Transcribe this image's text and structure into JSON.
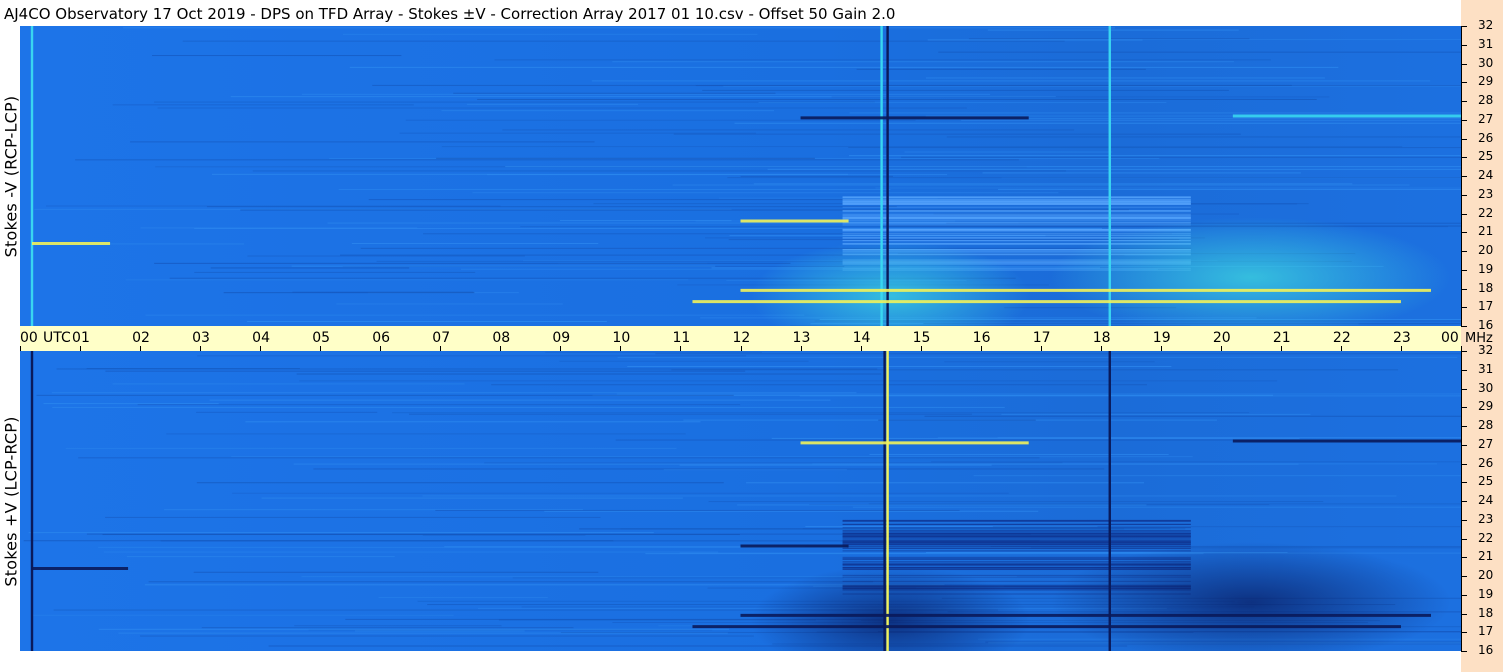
{
  "header": {
    "title": "AJ4CO Observatory  17 Oct 2019  -  DPS on TFD Array  -  Stokes ±V  -  Correction Array 2017 01 10.csv  -  Offset 50  Gain 2.0"
  },
  "colors": {
    "background_blue": "#1f73e6",
    "dark_band": "#0a1a5a",
    "cyan": "#39d6f0",
    "yellow": "#f2f25a",
    "time_bar": "#ffffc8",
    "freq_column": "#fde0c4"
  },
  "chart_data": [
    {
      "type": "heatmap",
      "ylabel": "Stokes -V (RCP-LCP)",
      "x_axis": {
        "label_prefix": "UTC",
        "range_hours": [
          0,
          24
        ],
        "tick_labels": [
          "00",
          "01",
          "02",
          "03",
          "04",
          "05",
          "06",
          "07",
          "08",
          "09",
          "10",
          "11",
          "12",
          "13",
          "14",
          "15",
          "16",
          "17",
          "18",
          "19",
          "20",
          "21",
          "22",
          "23",
          "00"
        ]
      },
      "y_axis": {
        "unit": "MHz",
        "range": [
          16,
          32
        ],
        "tick_labels": [
          "32",
          "31",
          "30",
          "29",
          "28",
          "27",
          "26",
          "25",
          "24",
          "23",
          "22",
          "21",
          "20",
          "19",
          "18",
          "17",
          "16"
        ]
      },
      "features": [
        {
          "kind": "vline",
          "hour": 0.2,
          "color": "cyan"
        },
        {
          "kind": "vline",
          "hour": 14.45,
          "color": "dark"
        },
        {
          "kind": "vline",
          "hour": 14.35,
          "color": "cyan"
        },
        {
          "kind": "vline",
          "hour": 18.15,
          "color": "cyan"
        },
        {
          "kind": "hband",
          "mhz": 27.1,
          "from": 13.0,
          "to": 16.8,
          "color": "dark"
        },
        {
          "kind": "hband",
          "mhz": 27.2,
          "from": 20.2,
          "to": 24.0,
          "color": "cyan"
        },
        {
          "kind": "hband",
          "mhz": 17.9,
          "from": 12.0,
          "to": 23.5,
          "color": "yellow"
        },
        {
          "kind": "hband",
          "mhz": 17.3,
          "from": 11.2,
          "to": 23.0,
          "color": "yellow"
        },
        {
          "kind": "hband",
          "mhz": 21.6,
          "from": 12.0,
          "to": 13.8,
          "color": "yellow"
        },
        {
          "kind": "hband",
          "mhz": 20.4,
          "from": 0.2,
          "to": 1.5,
          "color": "yellow"
        }
      ]
    },
    {
      "type": "heatmap",
      "ylabel": "Stokes +V (LCP-RCP)",
      "x_axis": {
        "label_prefix": "UTC",
        "range_hours": [
          0,
          24
        ],
        "tick_labels": [
          "00",
          "01",
          "02",
          "03",
          "04",
          "05",
          "06",
          "07",
          "08",
          "09",
          "10",
          "11",
          "12",
          "13",
          "14",
          "15",
          "16",
          "17",
          "18",
          "19",
          "20",
          "21",
          "22",
          "23",
          "00"
        ]
      },
      "y_axis": {
        "unit": "MHz",
        "range": [
          16,
          32
        ],
        "tick_labels": [
          "32",
          "31",
          "30",
          "29",
          "28",
          "27",
          "26",
          "25",
          "24",
          "23",
          "22",
          "21",
          "20",
          "19",
          "18",
          "17",
          "16"
        ]
      },
      "features": [
        {
          "kind": "vline",
          "hour": 0.2,
          "color": "dark"
        },
        {
          "kind": "vline",
          "hour": 14.45,
          "color": "yellow"
        },
        {
          "kind": "vline",
          "hour": 14.4,
          "color": "dark"
        },
        {
          "kind": "vline",
          "hour": 18.15,
          "color": "dark"
        },
        {
          "kind": "hband",
          "mhz": 27.1,
          "from": 13.0,
          "to": 16.8,
          "color": "yellow"
        },
        {
          "kind": "hband",
          "mhz": 27.2,
          "from": 20.2,
          "to": 24.0,
          "color": "dark"
        },
        {
          "kind": "hband",
          "mhz": 17.9,
          "from": 12.0,
          "to": 23.5,
          "color": "dark"
        },
        {
          "kind": "hband",
          "mhz": 17.3,
          "from": 11.2,
          "to": 23.0,
          "color": "dark"
        },
        {
          "kind": "hband",
          "mhz": 21.6,
          "from": 12.0,
          "to": 13.8,
          "color": "dark"
        },
        {
          "kind": "hband",
          "mhz": 20.4,
          "from": 0.2,
          "to": 1.8,
          "color": "dark"
        }
      ]
    }
  ]
}
